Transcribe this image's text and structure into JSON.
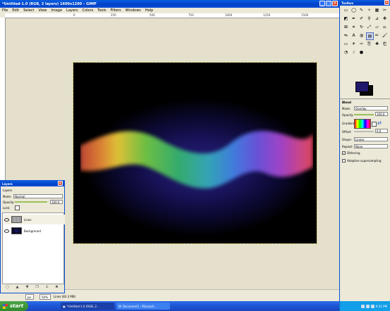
{
  "main_window": {
    "title": "*Untitled-1.0 (RGB, 2 layers) 1600x1200 – GIMP",
    "menu": [
      "File",
      "Edit",
      "Select",
      "View",
      "Image",
      "Layers",
      "Colors",
      "Tools",
      "Filters",
      "Windows",
      "Help"
    ],
    "ruler_ticks": [
      "0",
      "250",
      "500",
      "750",
      "1000",
      "1250",
      "1500"
    ],
    "status": {
      "unit": "px",
      "zoom": "50%",
      "message": "Lines (83.3 MB)"
    }
  },
  "layers_dock": {
    "title": "Layers",
    "tab_label": "Layers",
    "mode_label": "Mode:",
    "mode_value": "Normal",
    "opacity_label": "Opacity:",
    "opacity_value": "100.0",
    "lock_label": "Lock:",
    "layers": [
      {
        "name": "Lines",
        "visible": true
      },
      {
        "name": "Background",
        "visible": true
      }
    ]
  },
  "toolbox": {
    "title": "Toolbox",
    "options": {
      "section_title": "Blend",
      "mode_label": "Mode:",
      "mode_value": "Overlay",
      "opacity_label": "Opacity:",
      "opacity_value": "100.0",
      "gradient_label": "Gradient:",
      "offset_label": "Offset:",
      "offset_value": "0.0",
      "shape_label": "Shape:",
      "shape_value": "Linear",
      "repeat_label": "Repeat:",
      "repeat_value": "None",
      "dithering_label": "Dithering",
      "dithering": true,
      "adaptive_label": "Adaptive supersampling",
      "adaptive": false
    },
    "colors": {
      "foreground": "#20186a",
      "background": "#0a0a0a"
    }
  },
  "taskbar": {
    "start_label": "start",
    "tasks": [
      "*Untitled-1.0 (RGB, 2...",
      "Document1 - Microsof..."
    ],
    "clock": "9:31 PM"
  }
}
